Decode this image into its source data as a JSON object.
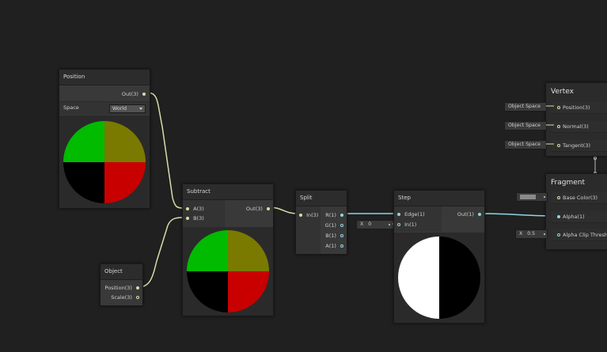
{
  "colors": {
    "background": "#202020",
    "wire_vector3": "#d8dca8",
    "wire_float": "#8ed6e6",
    "node_body": "#393939",
    "node_header": "#2c2c2c"
  },
  "nodes": {
    "position": {
      "title": "Position",
      "out_label": "Out(3)",
      "space_label": "Space",
      "space_value": "World",
      "dropdown_icon": "triangle-down-icon"
    },
    "object": {
      "title": "Object",
      "outputs": [
        "Position(3)",
        "Scale(3)"
      ]
    },
    "subtract": {
      "title": "Subtract",
      "inputs": [
        "A(3)",
        "B(3)"
      ],
      "out_label": "Out(3)"
    },
    "split": {
      "title": "Split",
      "input": "In(3)",
      "outputs": [
        "R(1)",
        "G(1)",
        "B(1)",
        "A(1)"
      ]
    },
    "step": {
      "title": "Step",
      "inputs": [
        "Edge(1)",
        "In(1)"
      ],
      "out_label": "Out(1)",
      "edge_default": {
        "axis": "X",
        "value": "0"
      }
    },
    "vertex": {
      "title": "Vertex",
      "rows": [
        {
          "label": "Position(3)",
          "pill": "Object Space"
        },
        {
          "label": "Normal(3)",
          "pill": "Object Space"
        },
        {
          "label": "Tangent(3)",
          "pill": "Object Space"
        }
      ]
    },
    "fragment": {
      "title": "Fragment",
      "rows": [
        {
          "label": "Base Color(3)"
        },
        {
          "label": "Alpha(1)"
        },
        {
          "label": "Alpha Clip Threshold",
          "axis": "X",
          "value": "0.5"
        }
      ]
    }
  }
}
